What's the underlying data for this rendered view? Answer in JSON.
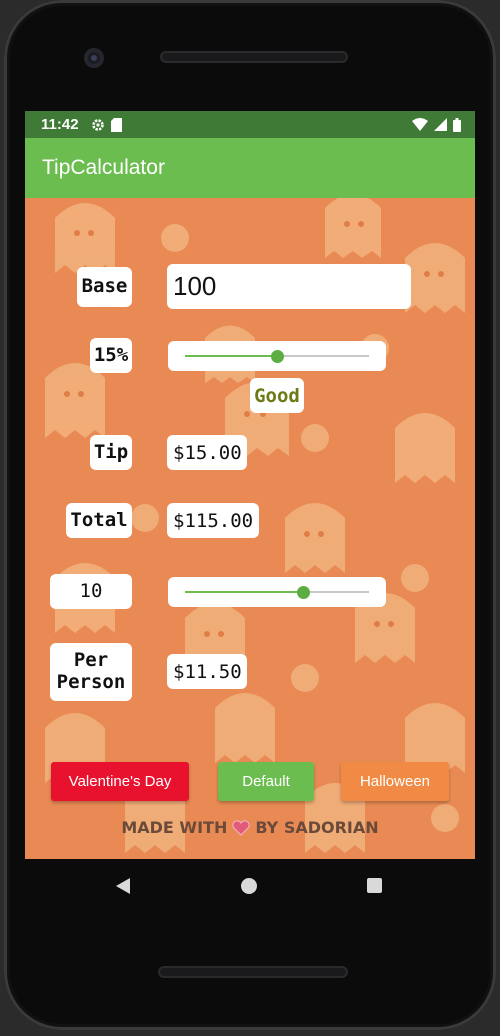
{
  "status_bar": {
    "time": "11:42"
  },
  "app_bar": {
    "title": "TipCalculator"
  },
  "form": {
    "base_label": "Base",
    "base_value": "100",
    "tip_percent_label": "15%",
    "tip_percent_slider": {
      "value": 15,
      "min": 0,
      "max": 30
    },
    "tip_description": "Good",
    "tip_label": "Tip",
    "tip_amount": "$15.00",
    "total_label": "Total",
    "total_amount": "$115.00",
    "split_count": "10",
    "split_slider": {
      "value": 10,
      "min": 1,
      "max": 15
    },
    "per_person_label_line1": "Per",
    "per_person_label_line2": "Person",
    "per_person_amount": "$11.50"
  },
  "buttons": {
    "valentines": {
      "label": "Valentine's Day",
      "color": "#e8122e"
    },
    "default": {
      "label": "Default",
      "color": "#6bbd4f"
    },
    "halloween": {
      "label": "Halloween",
      "color": "#f08a45"
    }
  },
  "footer": {
    "text_before": "MADE WITH",
    "heart_icon": "heart-icon",
    "text_after": "BY SADORIAN"
  },
  "theme": {
    "status_bar": "#3f7a37",
    "app_bar": "#6bbd4f",
    "background": "#e98a54",
    "accent": "#5cae42"
  }
}
